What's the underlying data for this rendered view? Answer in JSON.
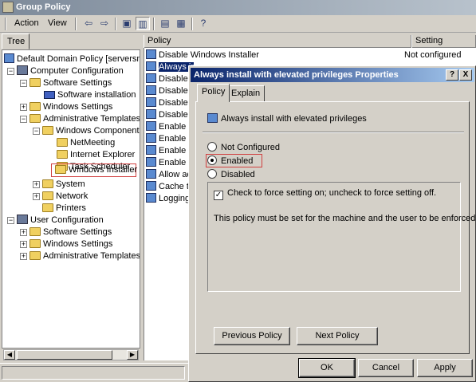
{
  "window": {
    "title": "Group Policy"
  },
  "menu": {
    "action": "Action",
    "view": "View"
  },
  "tree": {
    "tab_label": "Tree",
    "items": [
      {
        "label": "Default Domain Policy [serversms.Sl"
      },
      {
        "label": "Computer Configuration"
      },
      {
        "label": "Software Settings"
      },
      {
        "label": "Software installation"
      },
      {
        "label": "Windows Settings"
      },
      {
        "label": "Administrative Templates"
      },
      {
        "label": "Windows Components"
      },
      {
        "label": "NetMeeting"
      },
      {
        "label": "Internet Explorer"
      },
      {
        "label": "Task Scheduler"
      },
      {
        "label": "Windows Installer"
      },
      {
        "label": "System"
      },
      {
        "label": "Network"
      },
      {
        "label": "Printers"
      },
      {
        "label": "User Configuration"
      },
      {
        "label": "Software Settings"
      },
      {
        "label": "Windows Settings"
      },
      {
        "label": "Administrative Templates"
      }
    ]
  },
  "list": {
    "columns": {
      "policy": "Policy",
      "setting": "Setting"
    },
    "rows": [
      {
        "label": "Disable Windows Installer",
        "setting": "Not configured"
      },
      {
        "label": "Always ir"
      },
      {
        "label": "Disable rc"
      },
      {
        "label": "Disable bi"
      },
      {
        "label": "Disable p"
      },
      {
        "label": "Disable IE"
      },
      {
        "label": "Enable us"
      },
      {
        "label": "Enable us"
      },
      {
        "label": "Enable us"
      },
      {
        "label": "Enable us"
      },
      {
        "label": "Allow adr"
      },
      {
        "label": "Cache tra"
      },
      {
        "label": "Logging"
      }
    ]
  },
  "dialog": {
    "title": "Always install with elevated privileges Properties",
    "help_label": "?",
    "close_label": "X",
    "tabs": [
      "Policy",
      "Explain"
    ],
    "policy_name": "Always install with elevated privileges",
    "options": {
      "not_configured": "Not Configured",
      "enabled": "Enabled",
      "disabled": "Disabled"
    },
    "selected_option": "Enabled",
    "check_mark": "✓",
    "check_label": "Check to force setting on; uncheck to force setting off.",
    "description": "This policy must be set for the machine and the user to be enforced.",
    "buttons": {
      "previous": "Previous Policy",
      "next": "Next Policy",
      "ok": "OK",
      "cancel": "Cancel",
      "apply": "Apply"
    }
  }
}
